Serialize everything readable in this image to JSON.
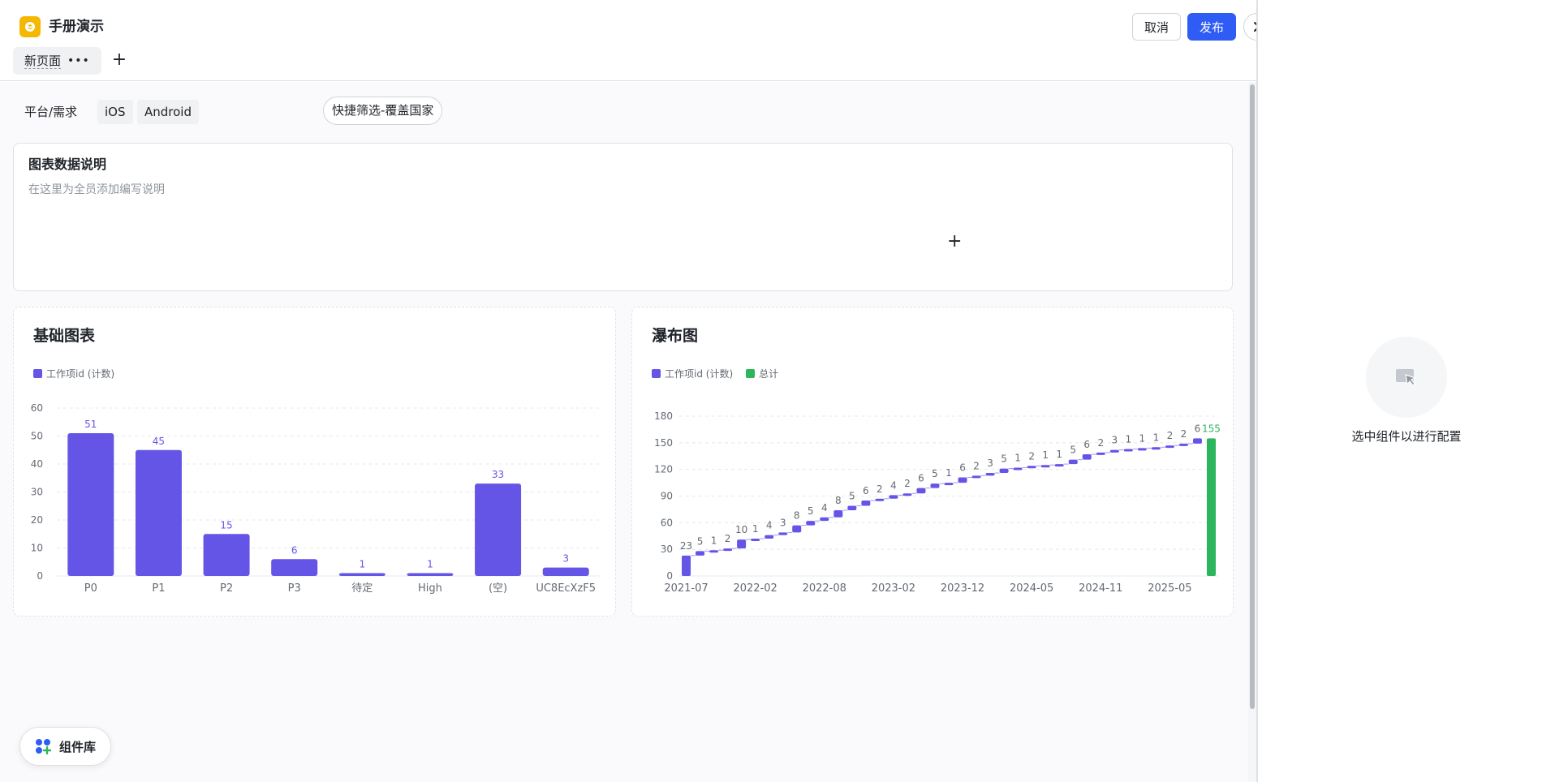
{
  "header": {
    "app_title": "手册演示",
    "tab_label": "新页面",
    "tab_more": "•••",
    "tab_add": "+",
    "cancel_label": "取消",
    "publish_label": "发布"
  },
  "filters": {
    "label": "平台/需求",
    "chips": [
      "iOS",
      "Android"
    ],
    "quick_filter": "快捷筛选-覆盖国家"
  },
  "description": {
    "title": "图表数据说明",
    "text": "在这里为全员添加编写说明",
    "plus": "+"
  },
  "bar_chart": {
    "title": "基础图表",
    "legend": "工作项id (计数)",
    "color": "#6555e6"
  },
  "waterfall_chart": {
    "title": "瀑布图",
    "legend_series": "工作项id (计数)",
    "legend_total": "总计",
    "color": "#6555e6",
    "total_color": "#2db55d"
  },
  "right_panel": {
    "text": "选中组件以进行配置",
    "icon": "cursor-select-icon"
  },
  "component_library": {
    "label": "组件库",
    "icon": "grid-plus-icon"
  },
  "colors": {
    "primary": "#2f5cf5",
    "logo": "#f5b800"
  },
  "chart_data": [
    {
      "type": "bar",
      "title": "基础图表",
      "categories": [
        "P0",
        "P1",
        "P2",
        "P3",
        "待定",
        "High",
        "(空)",
        "UC8EcXzF5"
      ],
      "series": [
        {
          "name": "工作项id (计数)",
          "values": [
            51,
            45,
            15,
            6,
            1,
            1,
            33,
            3
          ]
        }
      ],
      "y_ticks": [
        0,
        10,
        20,
        30,
        40,
        50,
        60
      ],
      "ylim": [
        0,
        60
      ],
      "grid": true,
      "legend": "top-left"
    },
    {
      "type": "waterfall",
      "title": "瀑布图",
      "x_ticks": [
        "2021-07",
        "2022-02",
        "2022-08",
        "2023-02",
        "2023-12",
        "2024-05",
        "2024-11",
        "2025-05"
      ],
      "series": [
        {
          "name": "工作项id (计数)",
          "values": [
            23,
            5,
            1,
            2,
            10,
            1,
            4,
            3,
            8,
            5,
            4,
            8,
            5,
            6,
            2,
            4,
            2,
            6,
            5,
            1,
            6,
            2,
            3,
            5,
            1,
            2,
            1,
            1,
            5,
            6,
            2,
            3,
            1,
            1,
            1,
            2,
            2,
            6
          ]
        },
        {
          "name": "总计",
          "values": [
            155
          ]
        }
      ],
      "y_ticks": [
        0,
        30,
        60,
        90,
        120,
        150,
        180
      ],
      "ylim": [
        0,
        180
      ],
      "grid": true,
      "legend": "top-left"
    }
  ]
}
